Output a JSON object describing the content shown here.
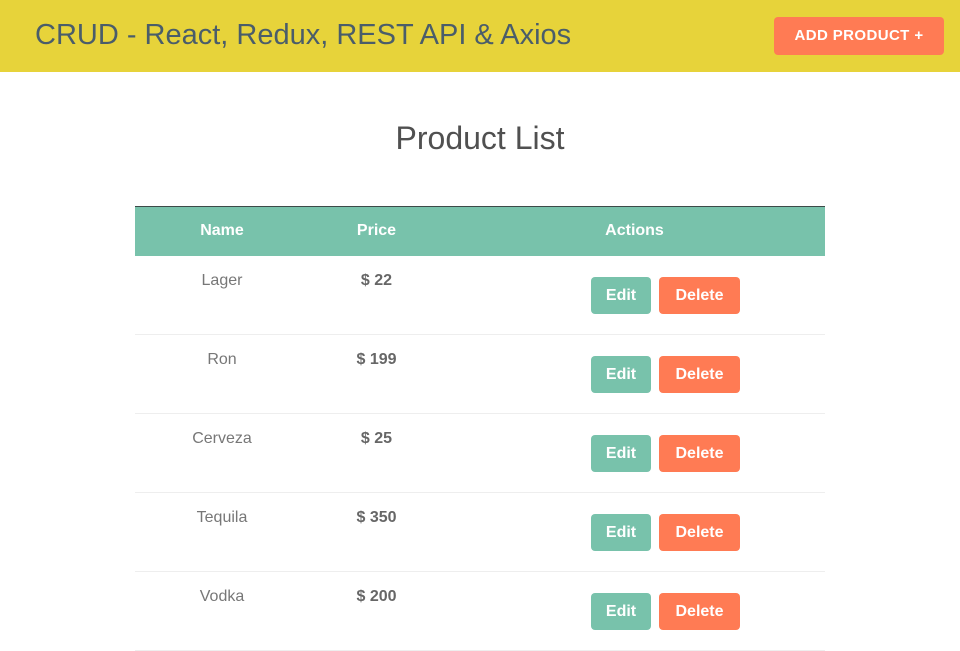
{
  "header": {
    "title": "CRUD - React, Redux, REST API & Axios",
    "add_button_label": "ADD PRODUCT +"
  },
  "main": {
    "page_title": "Product List",
    "table": {
      "columns": [
        "Name",
        "Price",
        "Actions"
      ],
      "rows": [
        {
          "name": "Lager",
          "price": "$ 22",
          "edit_label": "Edit",
          "delete_label": "Delete"
        },
        {
          "name": "Ron",
          "price": "$ 199",
          "edit_label": "Edit",
          "delete_label": "Delete"
        },
        {
          "name": "Cerveza",
          "price": "$ 25",
          "edit_label": "Edit",
          "delete_label": "Delete"
        },
        {
          "name": "Tequila",
          "price": "$ 350",
          "edit_label": "Edit",
          "delete_label": "Delete"
        },
        {
          "name": "Vodka",
          "price": "$ 200",
          "edit_label": "Edit",
          "delete_label": "Delete"
        }
      ]
    }
  },
  "colors": {
    "navbar_bg": "#e7d33a",
    "primary": "#78c2ab",
    "danger": "#ff7b54",
    "title_text": "#4a5d6a"
  }
}
